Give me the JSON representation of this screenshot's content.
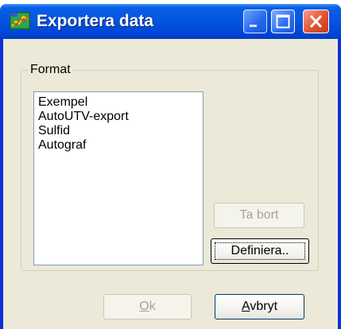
{
  "window": {
    "title": "Exportera data",
    "colors": {
      "titlebar": "#0454e0",
      "client": "#ece9d8",
      "close": "#e2522e"
    }
  },
  "group": {
    "label": "Format"
  },
  "list": {
    "items": [
      "Exempel",
      "AutoUTV-export",
      "Sulfid",
      "Autograf"
    ]
  },
  "buttons": {
    "remove": {
      "label": "Ta bort",
      "enabled": false
    },
    "define": {
      "label": "Definiera..",
      "focused": true
    },
    "ok": {
      "label": "Ok",
      "mnemonic": "O",
      "enabled": false
    },
    "cancel": {
      "label": "Avbryt",
      "mnemonic": "A",
      "enabled": true
    }
  }
}
